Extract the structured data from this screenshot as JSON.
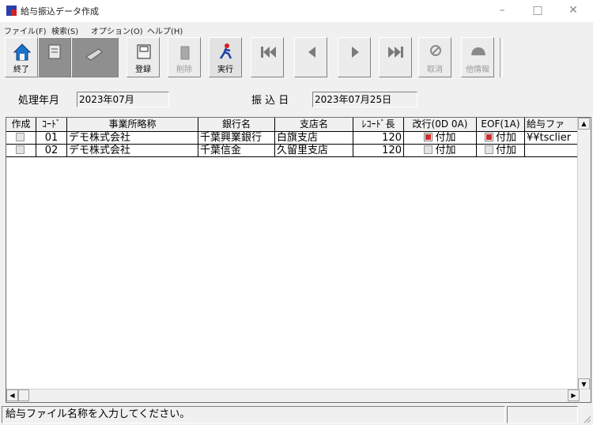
{
  "window": {
    "title": "給与振込データ作成",
    "minimize": "–",
    "maximize": "□",
    "close": "✕"
  },
  "menu": [
    "ファイル(F)",
    "検索(S)",
    "オプション(O)",
    "ヘルプ(H)"
  ],
  "toolbar": {
    "exit": "終了",
    "register": "登録",
    "delete": "削除",
    "execute": "実行",
    "cancel": "取消",
    "other_info": "他情報"
  },
  "info": {
    "period_label": "処理年月",
    "period_value": "2023年07月",
    "transfer_label": "振 込 日",
    "transfer_value": "2023年07月25日"
  },
  "grid": {
    "headers": [
      "作成",
      "ｺｰﾄﾞ",
      "事業所略称",
      "銀行名",
      "支店名",
      "ﾚｺｰﾄﾞ長",
      "改行(0D 0A)",
      "EOF(1A)",
      "給与ファ"
    ],
    "rows": [
      {
        "code": "01",
        "office": "デモ株式会社",
        "bank": "千葉興業銀行",
        "branch": "白旗支店",
        "record_len": "120",
        "newline": "付加",
        "eof": "付加",
        "file": "¥¥tsclier",
        "newline_on": true,
        "eof_on": true
      },
      {
        "code": "02",
        "office": "デモ株式会社",
        "bank": "千葉信金",
        "branch": "久留里支店",
        "record_len": "120",
        "newline": "付加",
        "eof": "付加",
        "file": "",
        "newline_on": false,
        "eof_on": false
      }
    ]
  },
  "status": {
    "message": "給与ファイル名称を入力してください。"
  }
}
